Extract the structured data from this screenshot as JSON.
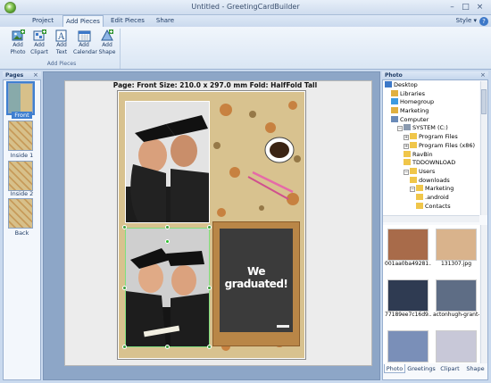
{
  "window": {
    "title": "Untitled - GreetingCardBuilder",
    "minimize": "–",
    "maximize": "□",
    "close": "×"
  },
  "ribbon_tabs": [
    "Project",
    "Add Pieces",
    "Edit Pieces",
    "Share"
  ],
  "active_tab": "Add Pieces",
  "style_menu": "Style ▾",
  "help": "?",
  "ribbon": {
    "buttons": [
      {
        "label1": "Add",
        "label2": "Photo",
        "icon": "add-photo-icon"
      },
      {
        "label1": "Add",
        "label2": "Clipart",
        "icon": "add-clipart-icon"
      },
      {
        "label1": "Add",
        "label2": "Text",
        "icon": "add-text-icon"
      },
      {
        "label1": "Add",
        "label2": "Calendar",
        "icon": "add-calendar-icon"
      },
      {
        "label1": "Add",
        "label2": "Shape",
        "icon": "add-shape-icon"
      }
    ],
    "group_label": "Add Pieces"
  },
  "pages_panel": {
    "title": "Pages",
    "close": "×",
    "pages": [
      "Front",
      "Inside 1",
      "Inside 2",
      "Back"
    ],
    "selected": "Front"
  },
  "canvas": {
    "page_info": "Page: Front   Size: 210.0 x 297.0 mm   Fold: HalfFold Tall",
    "board_text": "We graduated!"
  },
  "photo_panel": {
    "title": "Photo",
    "close": "×",
    "tree": [
      {
        "label": "Desktop",
        "indent": 0,
        "icon": "desktop-icon",
        "expander": ""
      },
      {
        "label": "Libraries",
        "indent": 1,
        "icon": "library-icon",
        "expander": ""
      },
      {
        "label": "Homegroup",
        "indent": 1,
        "icon": "homegroup-icon",
        "expander": ""
      },
      {
        "label": "Marketing",
        "indent": 1,
        "icon": "user-folder-icon",
        "expander": ""
      },
      {
        "label": "Computer",
        "indent": 1,
        "icon": "computer-icon",
        "expander": ""
      },
      {
        "label": "SYSTEM (C:)",
        "indent": 2,
        "icon": "drive-icon",
        "expander": "−"
      },
      {
        "label": "Program Files",
        "indent": 3,
        "icon": "folder-icon",
        "expander": "+"
      },
      {
        "label": "Program Files (x86)",
        "indent": 3,
        "icon": "folder-icon",
        "expander": "+"
      },
      {
        "label": "RavBin",
        "indent": 3,
        "icon": "folder-icon",
        "expander": ""
      },
      {
        "label": "TDDOWNLOAD",
        "indent": 3,
        "icon": "folder-icon",
        "expander": ""
      },
      {
        "label": "Users",
        "indent": 3,
        "icon": "folder-icon",
        "expander": "−"
      },
      {
        "label": "downloads",
        "indent": 4,
        "icon": "folder-icon",
        "expander": ""
      },
      {
        "label": "Marketing",
        "indent": 4,
        "icon": "folder-icon",
        "expander": "−"
      },
      {
        "label": ".android",
        "indent": 5,
        "icon": "folder-icon",
        "expander": ""
      },
      {
        "label": "Contacts",
        "indent": 5,
        "icon": "folder-icon",
        "expander": ""
      }
    ],
    "thumbnails": [
      {
        "label": "001aa0ba49281...",
        "color": "#a86b4a"
      },
      {
        "label": "131307.jpg",
        "color": "#d9b38c"
      },
      {
        "label": "77189ee7c16d9...",
        "color": "#2f3b52"
      },
      {
        "label": "actonhugh-grant-...",
        "color": "#5e6d85"
      },
      {
        "label": "",
        "color": "#7a8fb8"
      },
      {
        "label": "",
        "color": "#c8c8d8"
      }
    ],
    "bottom_tabs": [
      "Photo",
      "Greetings",
      "Clipart",
      "Shape"
    ],
    "active_bottom_tab": "Photo"
  }
}
